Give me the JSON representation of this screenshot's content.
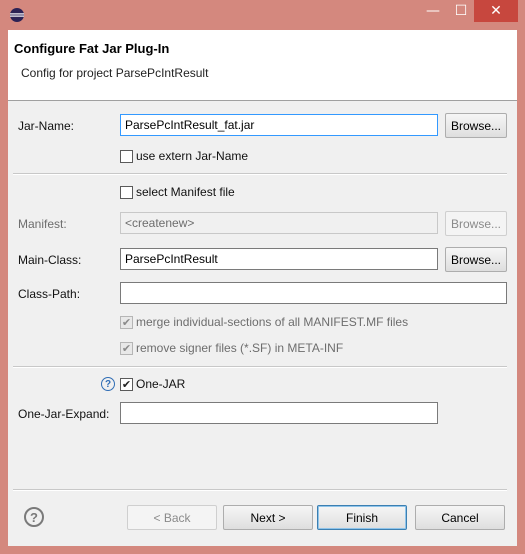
{
  "window": {
    "title": "",
    "icon": "eclipse-icon",
    "minimize_glyph": "—",
    "maximize_glyph": "☐",
    "close_glyph": "✕",
    "accent": "#d4887e"
  },
  "header": {
    "title": "Configure Fat Jar Plug-In",
    "subtitle": "Config for project ParsePcIntResult"
  },
  "jar_name": {
    "label": "Jar-Name:",
    "value": "ParsePcIntResult_fat.jar",
    "browse": "Browse..."
  },
  "use_extern": {
    "label": "use extern Jar-Name",
    "checked": false
  },
  "select_manifest": {
    "label": "select Manifest file",
    "checked": false
  },
  "manifest": {
    "label": "Manifest:",
    "value": "<createnew>",
    "browse": "Browse..."
  },
  "main_class": {
    "label": "Main-Class:",
    "value": "ParsePcIntResult",
    "browse": "Browse..."
  },
  "class_path": {
    "label": "Class-Path:",
    "value": ""
  },
  "merge_sections": {
    "label": "merge individual-sections of all MANIFEST.MF files",
    "checked": true,
    "check_glyph": "✔"
  },
  "remove_signer": {
    "label": "remove signer files (*.SF) in META-INF",
    "checked": true,
    "check_glyph": "✔"
  },
  "one_jar": {
    "label": "One-JAR",
    "checked": true,
    "check_glyph": "✔",
    "help_glyph": "?"
  },
  "one_jar_expand": {
    "label": "One-Jar-Expand:",
    "value": ""
  },
  "footer": {
    "help_glyph": "?",
    "back": "< Back",
    "next": "Next >",
    "finish": "Finish",
    "cancel": "Cancel"
  }
}
